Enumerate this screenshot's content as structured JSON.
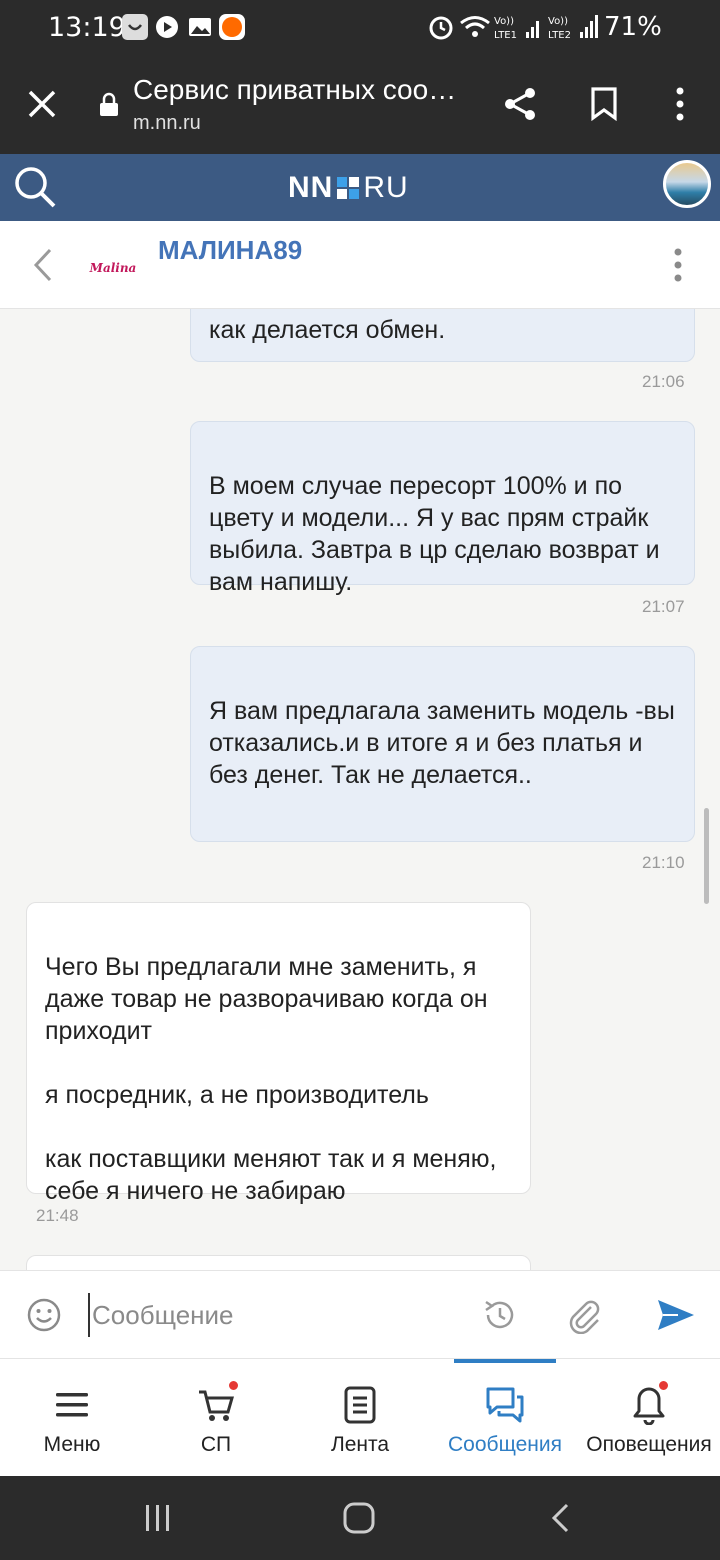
{
  "status_bar": {
    "time": "13:19",
    "battery": "71%",
    "icons": [
      "notification-icon",
      "media-icon",
      "gallery-icon",
      "app-icon",
      "alarm-icon",
      "wifi-icon",
      "signal-lte1-icon",
      "signal-lte2-icon"
    ]
  },
  "browser": {
    "title": "Сервис приватных соо…",
    "url": "m.nn.ru",
    "icons": [
      "close-icon",
      "lock-icon",
      "share-icon",
      "bookmark-icon",
      "more-icon"
    ]
  },
  "site": {
    "logo_left": "NN",
    "logo_right": "RU",
    "brand_colors": [
      "#ffffff",
      "#3da0e8"
    ]
  },
  "chat": {
    "contact_name": "МАЛИНА89",
    "avatar_text": "Malina"
  },
  "messages": [
    {
      "direction": "out",
      "text": "как делается обмен.",
      "time": "21:06"
    },
    {
      "direction": "out",
      "text": "В моем случае пересорт 100% и по цвету и модели... Я у вас прям страйк выбила. Завтра в цр сделаю возврат и вам напишу.",
      "time": "21:07"
    },
    {
      "direction": "out",
      "text": "Я вам предлагала заменить модель -вы отказались.и в итоге я и без платья и без денег. Так не делается..",
      "time": "21:10"
    },
    {
      "direction": "in",
      "text": "Чего Вы предлагали мне заменить, я даже товар не разворачиваю когда он приходит\n\nя посредник, а не производитель\n\nкак поставщики меняют так и я меняю, себе я ничего не забираю",
      "time": "21:48"
    }
  ],
  "composer": {
    "placeholder": "Сообщение"
  },
  "nav": {
    "items": [
      {
        "label": "Меню",
        "icon": "menu-icon"
      },
      {
        "label": "СП",
        "icon": "cart-icon",
        "badge": true
      },
      {
        "label": "Лента",
        "icon": "feed-icon"
      },
      {
        "label": "Сообщения",
        "icon": "messages-icon",
        "active": true
      },
      {
        "label": "Оповещения",
        "icon": "bell-icon",
        "badge": true
      }
    ],
    "accent": "#2f7ec4"
  }
}
